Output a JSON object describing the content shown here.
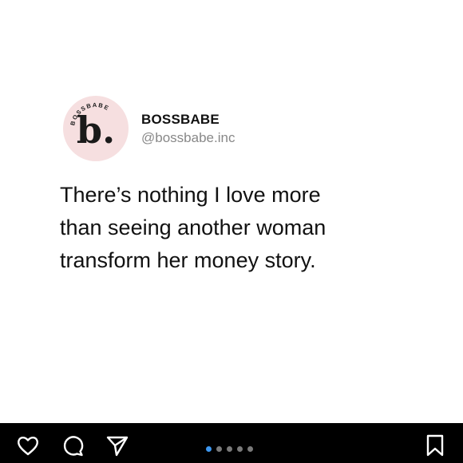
{
  "post": {
    "account": {
      "display_name": "BOSSBABE",
      "handle": "@bossbabe.inc",
      "logo_letter": "b.",
      "logo_ring_text": "BOSSBABE"
    },
    "quote_lines": [
      "There’s nothing I love more",
      "than seeing another woman",
      "transform her money story."
    ],
    "colors": {
      "avatar_bg": "#f6dfe0",
      "active_dot": "#3d97f0"
    }
  },
  "actions": {
    "like_icon": "heart-icon",
    "comment_icon": "comment-icon",
    "share_icon": "send-icon",
    "save_icon": "bookmark-icon"
  },
  "carousel": {
    "total": 5,
    "current": 1
  }
}
